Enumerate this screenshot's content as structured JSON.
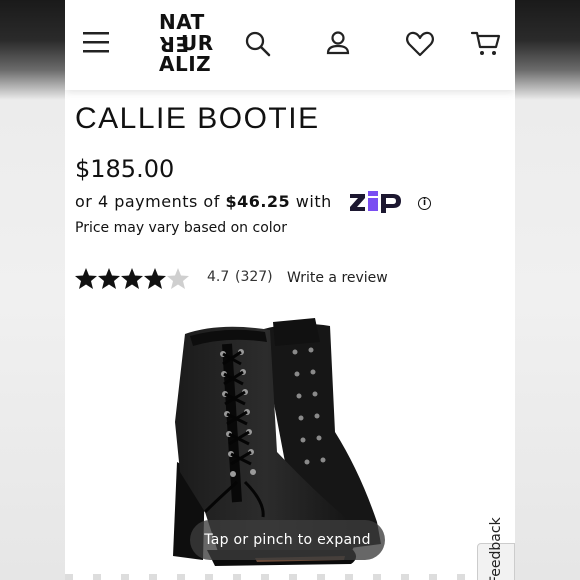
{
  "header": {
    "menu_icon": "hamburger-menu-icon",
    "logo_text": "NATURALIZER",
    "logo_rows": [
      "NAT",
      "UR",
      "ALIZ",
      "ER"
    ],
    "search_icon": "search-icon",
    "account_icon": "account-icon",
    "wishlist_icon": "heart-icon",
    "cart_icon": "cart-icon"
  },
  "product": {
    "title": "CALLIE BOOTIE",
    "price": "$185.00",
    "installments_prefix": "or 4 payments of",
    "installment_amount": "$46.25",
    "installments_suffix": "with",
    "payment_provider_logo": "Zip",
    "price_note": "Price may vary based on color",
    "rating": {
      "stars": 4.7,
      "value": "4.7",
      "count": "(327)",
      "write_review": "Write a review"
    }
  },
  "image_overlay": {
    "expand_hint": "Tap or pinch to expand"
  },
  "feedback": {
    "label": "Feedback"
  },
  "colors": {
    "zip_purple": "#7a4df2",
    "zip_dark": "#1c1730",
    "text": "#111111"
  }
}
